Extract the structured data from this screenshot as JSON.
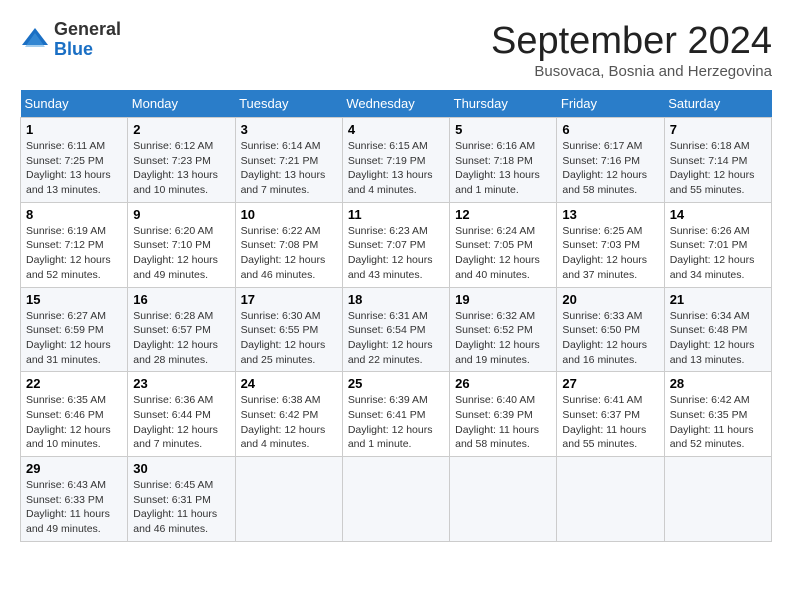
{
  "header": {
    "logo_general": "General",
    "logo_blue": "Blue",
    "month_title": "September 2024",
    "subtitle": "Busovaca, Bosnia and Herzegovina"
  },
  "days_of_week": [
    "Sunday",
    "Monday",
    "Tuesday",
    "Wednesday",
    "Thursday",
    "Friday",
    "Saturday"
  ],
  "weeks": [
    [
      {
        "day": "1",
        "sunrise": "6:11 AM",
        "sunset": "7:25 PM",
        "daylight": "Daylight: 13 hours and 13 minutes."
      },
      {
        "day": "2",
        "sunrise": "6:12 AM",
        "sunset": "7:23 PM",
        "daylight": "Daylight: 13 hours and 10 minutes."
      },
      {
        "day": "3",
        "sunrise": "6:14 AM",
        "sunset": "7:21 PM",
        "daylight": "Daylight: 13 hours and 7 minutes."
      },
      {
        "day": "4",
        "sunrise": "6:15 AM",
        "sunset": "7:19 PM",
        "daylight": "Daylight: 13 hours and 4 minutes."
      },
      {
        "day": "5",
        "sunrise": "6:16 AM",
        "sunset": "7:18 PM",
        "daylight": "Daylight: 13 hours and 1 minute."
      },
      {
        "day": "6",
        "sunrise": "6:17 AM",
        "sunset": "7:16 PM",
        "daylight": "Daylight: 12 hours and 58 minutes."
      },
      {
        "day": "7",
        "sunrise": "6:18 AM",
        "sunset": "7:14 PM",
        "daylight": "Daylight: 12 hours and 55 minutes."
      }
    ],
    [
      {
        "day": "8",
        "sunrise": "6:19 AM",
        "sunset": "7:12 PM",
        "daylight": "Daylight: 12 hours and 52 minutes."
      },
      {
        "day": "9",
        "sunrise": "6:20 AM",
        "sunset": "7:10 PM",
        "daylight": "Daylight: 12 hours and 49 minutes."
      },
      {
        "day": "10",
        "sunrise": "6:22 AM",
        "sunset": "7:08 PM",
        "daylight": "Daylight: 12 hours and 46 minutes."
      },
      {
        "day": "11",
        "sunrise": "6:23 AM",
        "sunset": "7:07 PM",
        "daylight": "Daylight: 12 hours and 43 minutes."
      },
      {
        "day": "12",
        "sunrise": "6:24 AM",
        "sunset": "7:05 PM",
        "daylight": "Daylight: 12 hours and 40 minutes."
      },
      {
        "day": "13",
        "sunrise": "6:25 AM",
        "sunset": "7:03 PM",
        "daylight": "Daylight: 12 hours and 37 minutes."
      },
      {
        "day": "14",
        "sunrise": "6:26 AM",
        "sunset": "7:01 PM",
        "daylight": "Daylight: 12 hours and 34 minutes."
      }
    ],
    [
      {
        "day": "15",
        "sunrise": "6:27 AM",
        "sunset": "6:59 PM",
        "daylight": "Daylight: 12 hours and 31 minutes."
      },
      {
        "day": "16",
        "sunrise": "6:28 AM",
        "sunset": "6:57 PM",
        "daylight": "Daylight: 12 hours and 28 minutes."
      },
      {
        "day": "17",
        "sunrise": "6:30 AM",
        "sunset": "6:55 PM",
        "daylight": "Daylight: 12 hours and 25 minutes."
      },
      {
        "day": "18",
        "sunrise": "6:31 AM",
        "sunset": "6:54 PM",
        "daylight": "Daylight: 12 hours and 22 minutes."
      },
      {
        "day": "19",
        "sunrise": "6:32 AM",
        "sunset": "6:52 PM",
        "daylight": "Daylight: 12 hours and 19 minutes."
      },
      {
        "day": "20",
        "sunrise": "6:33 AM",
        "sunset": "6:50 PM",
        "daylight": "Daylight: 12 hours and 16 minutes."
      },
      {
        "day": "21",
        "sunrise": "6:34 AM",
        "sunset": "6:48 PM",
        "daylight": "Daylight: 12 hours and 13 minutes."
      }
    ],
    [
      {
        "day": "22",
        "sunrise": "6:35 AM",
        "sunset": "6:46 PM",
        "daylight": "Daylight: 12 hours and 10 minutes."
      },
      {
        "day": "23",
        "sunrise": "6:36 AM",
        "sunset": "6:44 PM",
        "daylight": "Daylight: 12 hours and 7 minutes."
      },
      {
        "day": "24",
        "sunrise": "6:38 AM",
        "sunset": "6:42 PM",
        "daylight": "Daylight: 12 hours and 4 minutes."
      },
      {
        "day": "25",
        "sunrise": "6:39 AM",
        "sunset": "6:41 PM",
        "daylight": "Daylight: 12 hours and 1 minute."
      },
      {
        "day": "26",
        "sunrise": "6:40 AM",
        "sunset": "6:39 PM",
        "daylight": "Daylight: 11 hours and 58 minutes."
      },
      {
        "day": "27",
        "sunrise": "6:41 AM",
        "sunset": "6:37 PM",
        "daylight": "Daylight: 11 hours and 55 minutes."
      },
      {
        "day": "28",
        "sunrise": "6:42 AM",
        "sunset": "6:35 PM",
        "daylight": "Daylight: 11 hours and 52 minutes."
      }
    ],
    [
      {
        "day": "29",
        "sunrise": "6:43 AM",
        "sunset": "6:33 PM",
        "daylight": "Daylight: 11 hours and 49 minutes."
      },
      {
        "day": "30",
        "sunrise": "6:45 AM",
        "sunset": "6:31 PM",
        "daylight": "Daylight: 11 hours and 46 minutes."
      },
      null,
      null,
      null,
      null,
      null
    ]
  ]
}
